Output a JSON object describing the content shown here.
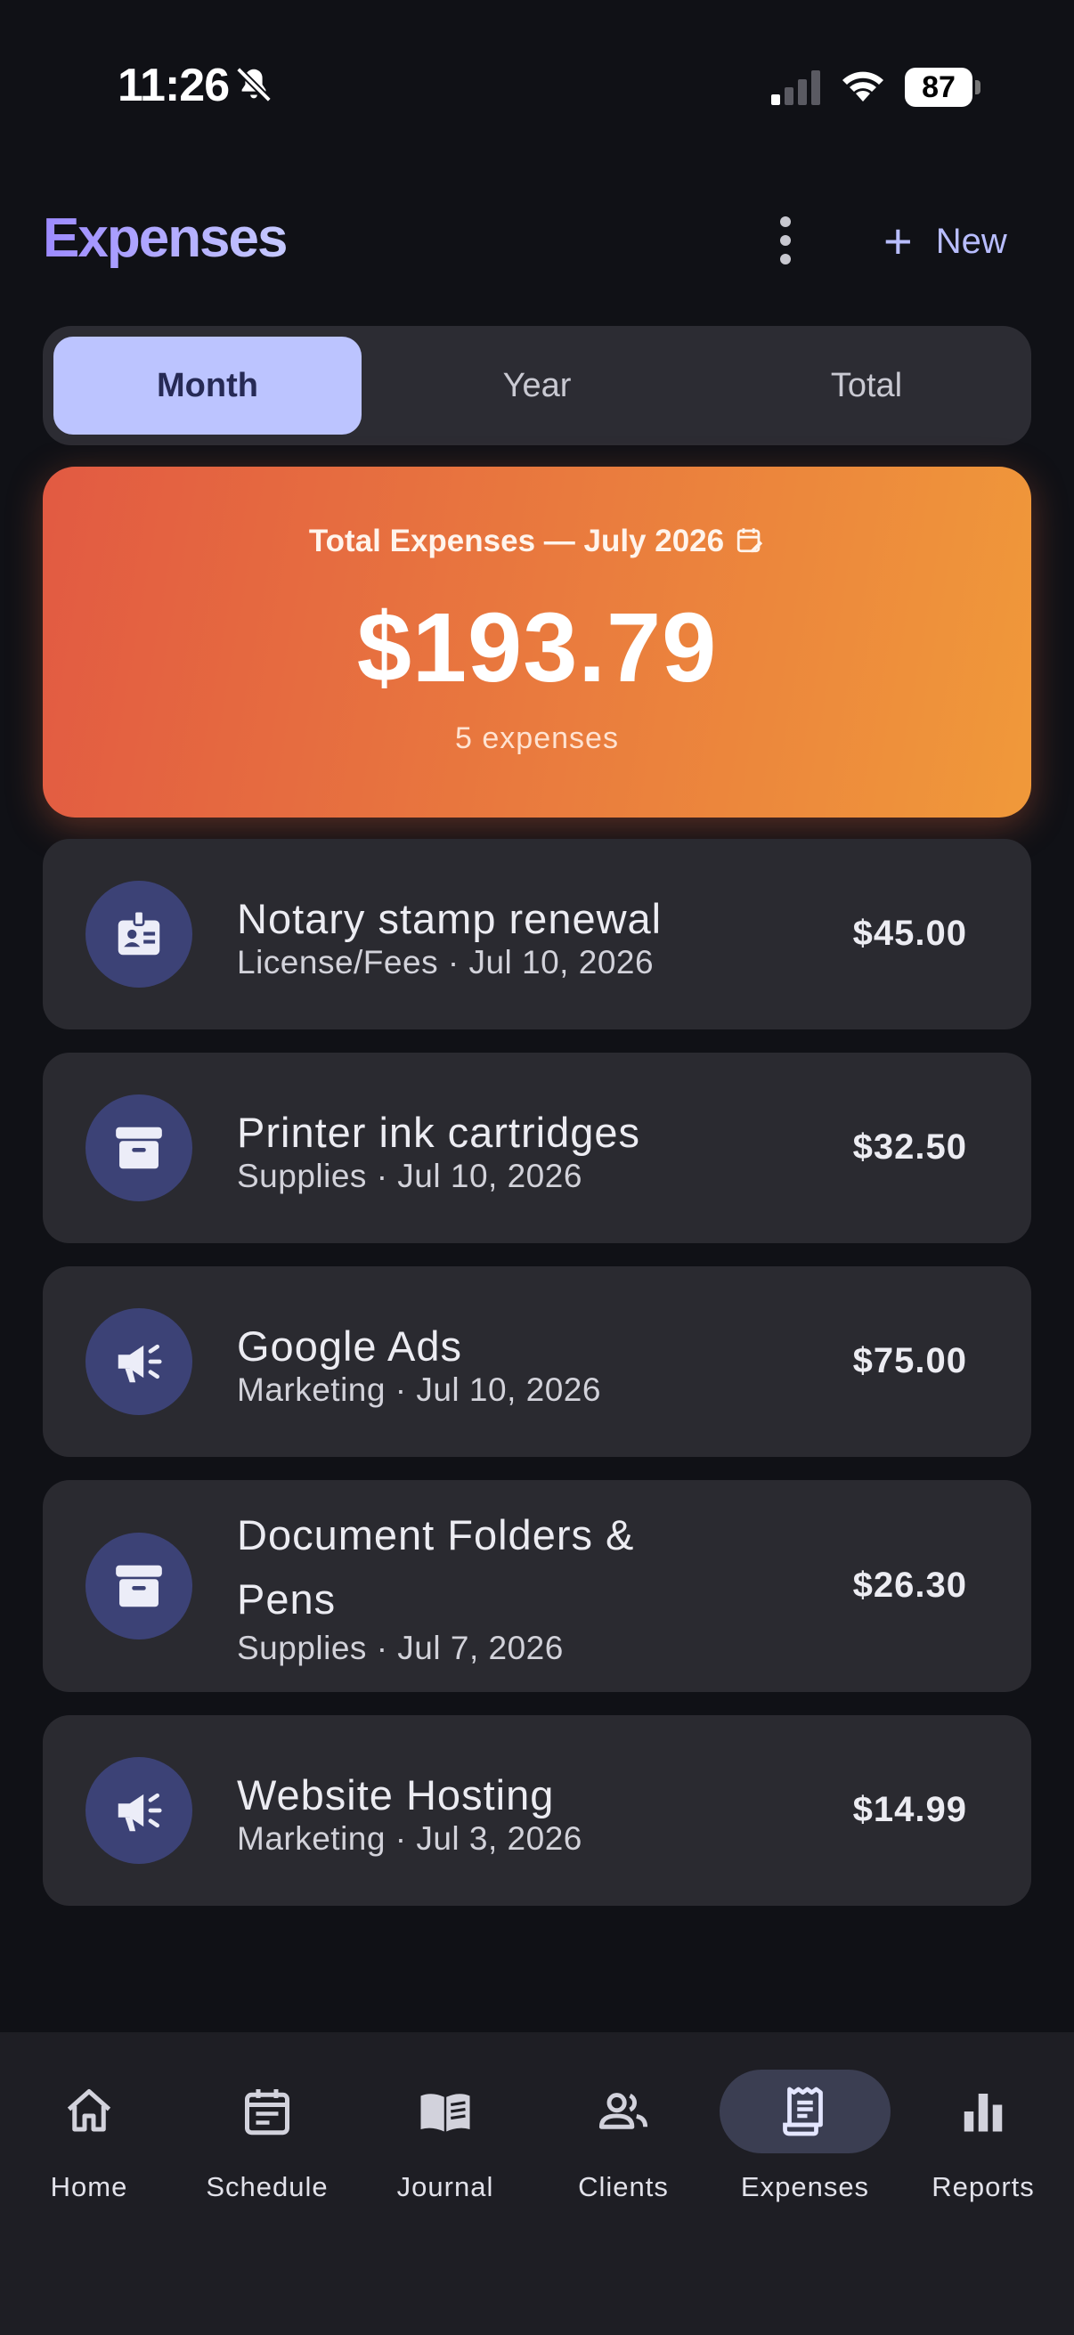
{
  "status_bar": {
    "time": "11:26",
    "battery": "87"
  },
  "header": {
    "title": "Expenses",
    "new_label": "New"
  },
  "tabs": [
    {
      "label": "Month",
      "active": true
    },
    {
      "label": "Year",
      "active": false
    },
    {
      "label": "Total",
      "active": false
    }
  ],
  "summary": {
    "label": "Total Expenses — July 2026",
    "amount": "$193.79",
    "count": "5 expenses"
  },
  "expenses": [
    {
      "title": "Notary stamp renewal",
      "subtitle": "License/Fees · Jul 10, 2026",
      "amount": "$45.00",
      "icon": "badge-icon"
    },
    {
      "title": "Printer ink cartridges",
      "subtitle": "Supplies · Jul 10, 2026",
      "amount": "$32.50",
      "icon": "archive-icon"
    },
    {
      "title": "Google Ads",
      "subtitle": "Marketing · Jul 10, 2026",
      "amount": "$75.00",
      "icon": "megaphone-icon"
    },
    {
      "title": "Document Folders & Pens",
      "subtitle": "Supplies · Jul 7, 2026",
      "amount": "$26.30",
      "icon": "archive-icon"
    },
    {
      "title": "Website Hosting",
      "subtitle": "Marketing · Jul 3, 2026",
      "amount": "$14.99",
      "icon": "megaphone-icon"
    }
  ],
  "nav": [
    {
      "label": "Home",
      "icon": "home-icon"
    },
    {
      "label": "Schedule",
      "icon": "calendar-icon"
    },
    {
      "label": "Journal",
      "icon": "book-icon"
    },
    {
      "label": "Clients",
      "icon": "people-icon"
    },
    {
      "label": "Expenses",
      "icon": "receipt-icon",
      "active": true
    },
    {
      "label": "Reports",
      "icon": "bar-chart-icon"
    }
  ],
  "colors": {
    "accent": "#bcc4ff",
    "summary_start": "#e25a42",
    "summary_end": "#f0993a",
    "icon_bg": "#3c4276"
  }
}
